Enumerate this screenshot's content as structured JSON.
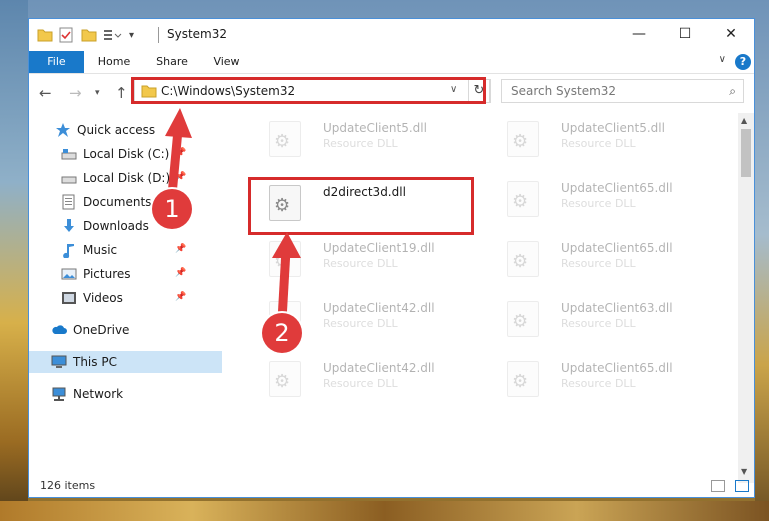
{
  "window": {
    "title": "System32"
  },
  "ribbon": {
    "tabs": [
      "File",
      "Home",
      "Share",
      "View"
    ],
    "help": "?"
  },
  "nav": {
    "address": "C:\\Windows\\System32",
    "search_placeholder": "Search System32"
  },
  "sidebar": {
    "items": [
      {
        "label": "Quick access",
        "icon": "star-icon"
      },
      {
        "label": "Local Disk (C:)",
        "icon": "drive-icon"
      },
      {
        "label": "Local Disk (D:)",
        "icon": "drive-icon"
      },
      {
        "label": "Documents",
        "icon": "documents-icon"
      },
      {
        "label": "Downloads",
        "icon": "download-icon"
      },
      {
        "label": "Music",
        "icon": "music-icon"
      },
      {
        "label": "Pictures",
        "icon": "pictures-icon"
      },
      {
        "label": "Videos",
        "icon": "videos-icon"
      },
      {
        "label": "OneDrive",
        "icon": "cloud-icon"
      },
      {
        "label": "This PC",
        "icon": "computer-icon"
      },
      {
        "label": "Network",
        "icon": "network-icon"
      }
    ]
  },
  "files": {
    "left": [
      {
        "name": "UpdateClient5.dll",
        "type": "Resource DLL"
      },
      {
        "name": "d2direct3d.dll",
        "type": ""
      },
      {
        "name": "UpdateClient19.dll",
        "type": "Resource DLL"
      },
      {
        "name": "UpdateClient42.dll",
        "type": "Resource DLL"
      },
      {
        "name": "UpdateClient42.dll",
        "type": "Resource DLL"
      }
    ],
    "right": [
      {
        "name": "UpdateClient5.dll",
        "type": "Resource DLL"
      },
      {
        "name": "UpdateClient65.dll",
        "type": "Resource DLL"
      },
      {
        "name": "UpdateClient65.dll",
        "type": "Resource DLL"
      },
      {
        "name": "UpdateClient63.dll",
        "type": "Resource DLL"
      },
      {
        "name": "UpdateClient65.dll",
        "type": "Resource DLL"
      }
    ]
  },
  "status": {
    "count": "126 items"
  },
  "annotations": {
    "step1": "1",
    "step2": "2",
    "highlight_color": "#d62b2b",
    "callout_color": "#e03b3b"
  },
  "colors": {
    "accent": "#1979ca",
    "selection": "#cce4f7"
  }
}
